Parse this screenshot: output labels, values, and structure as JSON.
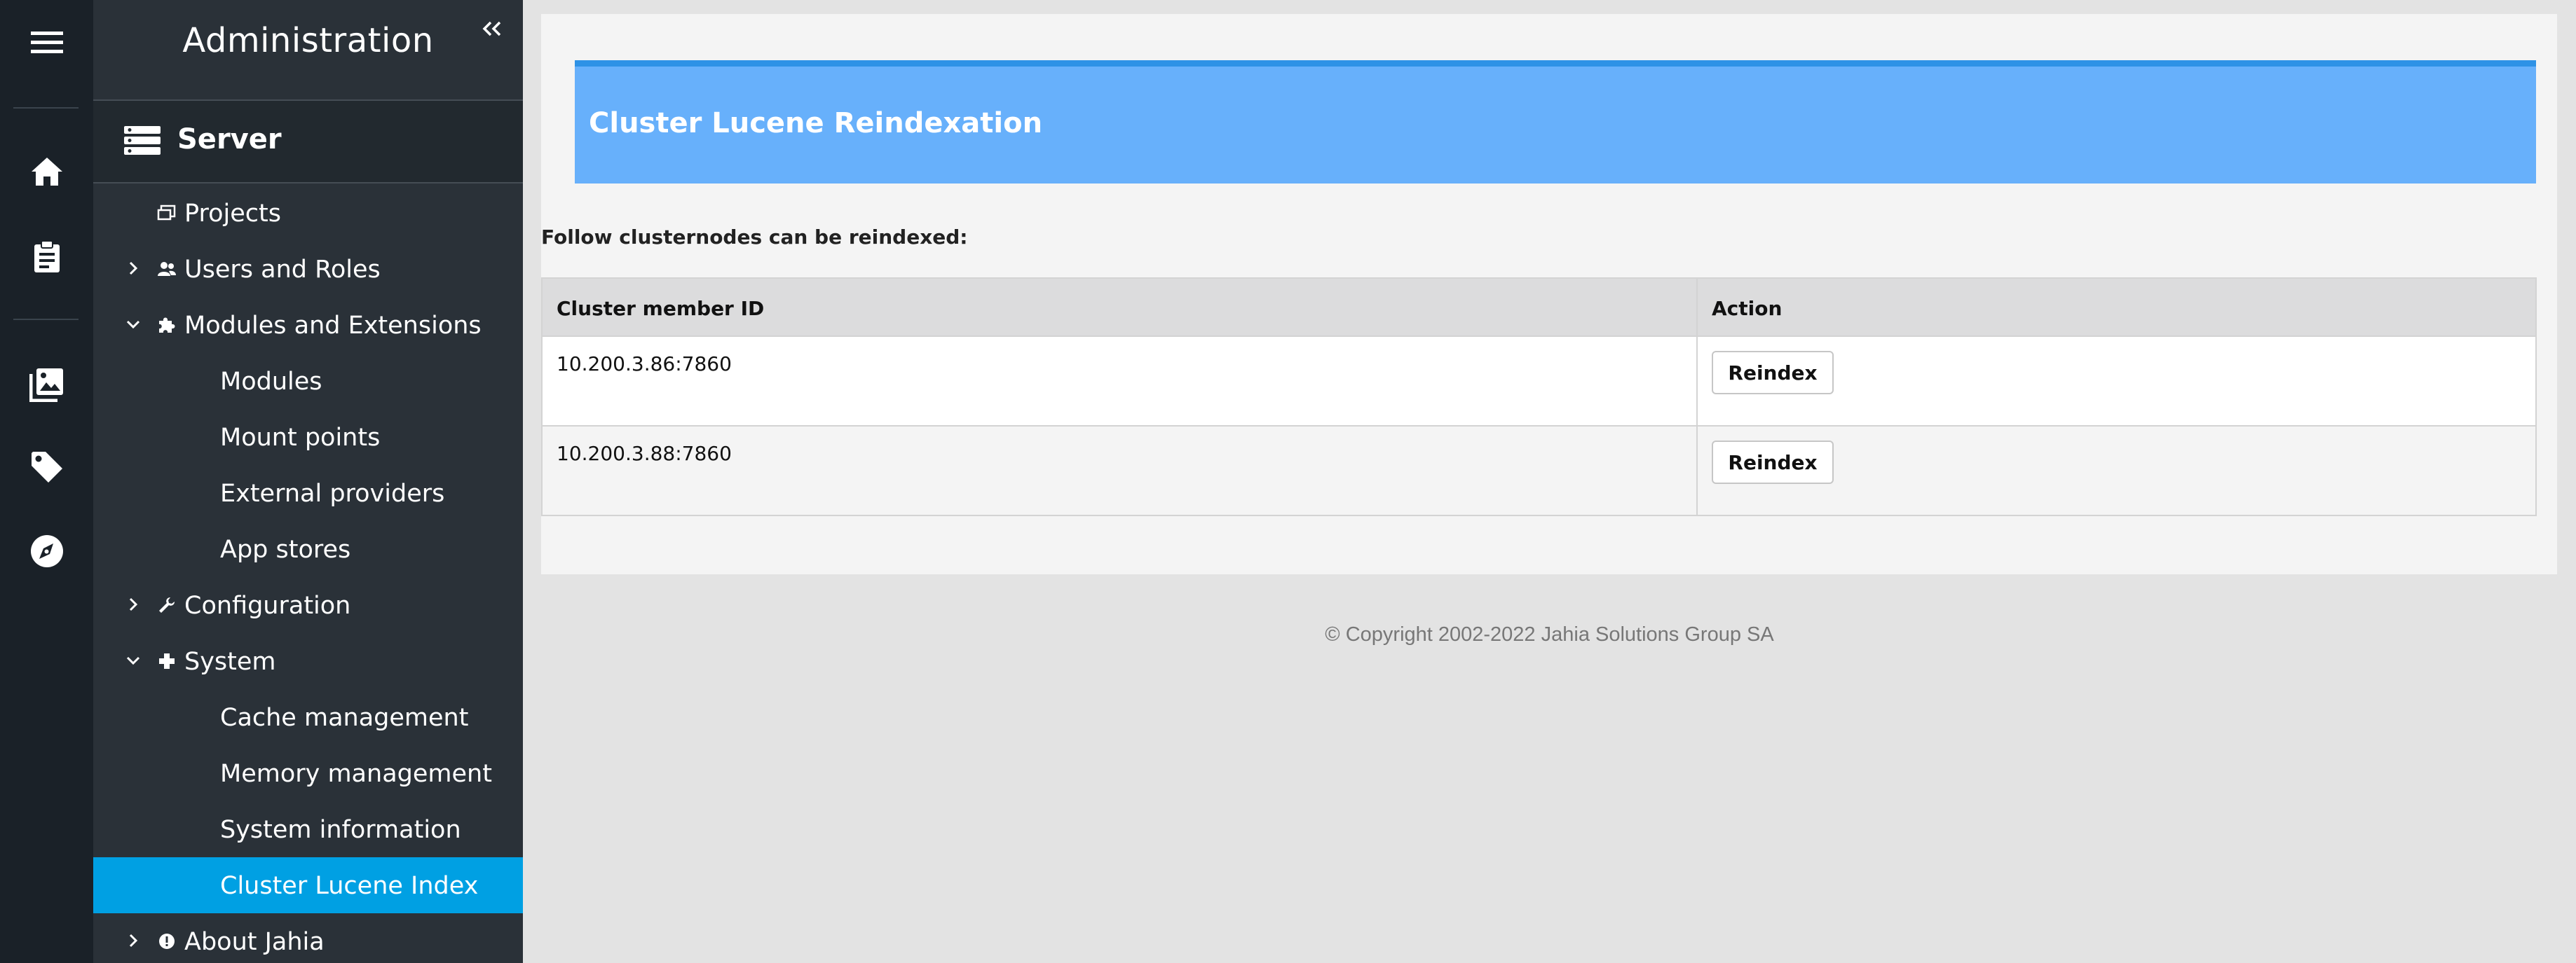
{
  "sidebar": {
    "title": "Administration",
    "section": "Server",
    "items": [
      {
        "label": "Projects"
      },
      {
        "label": "Users and Roles"
      },
      {
        "label": "Modules and Extensions"
      },
      {
        "label": "Modules"
      },
      {
        "label": "Mount points"
      },
      {
        "label": "External providers"
      },
      {
        "label": "App stores"
      },
      {
        "label": "Configuration"
      },
      {
        "label": "System"
      },
      {
        "label": "Cache management"
      },
      {
        "label": "Memory management"
      },
      {
        "label": "System information"
      },
      {
        "label": "Cluster Lucene Index"
      },
      {
        "label": "About Jahia"
      }
    ]
  },
  "rail": {
    "icons": [
      "menu-icon",
      "home-icon",
      "clipboard-icon",
      "images-icon",
      "tag-icon",
      "compass-icon"
    ]
  },
  "main": {
    "banner_title": "Cluster Lucene Reindexation",
    "intro": "Follow clusternodes can be reindexed:",
    "table": {
      "headers": [
        "Cluster member ID",
        "Action"
      ],
      "rows": [
        {
          "id": "10.200.3.86:7860",
          "action": "Reindex"
        },
        {
          "id": "10.200.3.88:7860",
          "action": "Reindex"
        }
      ]
    },
    "copyright": "© Copyright 2002-2022 Jahia Solutions Group SA"
  },
  "colors": {
    "rail_bg": "#1a2128",
    "sidebar_bg": "#2a3138",
    "active_item": "#00a0e3",
    "banner": "#67b0fb",
    "banner_top": "#2e92e6"
  }
}
